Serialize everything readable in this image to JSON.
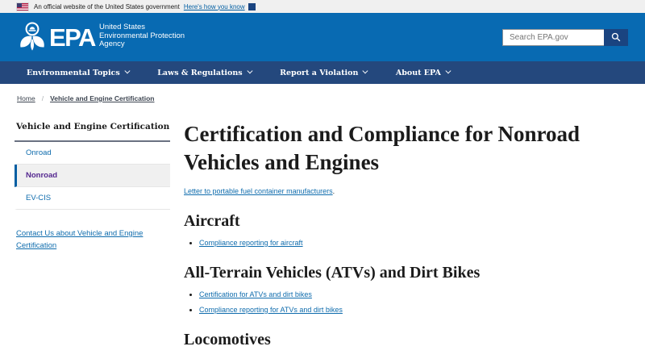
{
  "banner": {
    "text": "An official website of the United States government",
    "link_label": "Here's how you know"
  },
  "header": {
    "logo": {
      "acronym": "EPA",
      "tagline_lines": [
        "United States",
        "Environmental Protection",
        "Agency"
      ]
    },
    "search": {
      "placeholder": "Search EPA.gov"
    }
  },
  "nav": {
    "items": [
      {
        "label": "Environmental Topics"
      },
      {
        "label": "Laws & Regulations"
      },
      {
        "label": "Report a Violation"
      },
      {
        "label": "About EPA"
      }
    ]
  },
  "breadcrumb": {
    "separator": "/",
    "items": [
      {
        "label": "Home"
      },
      {
        "label": "Vehicle and Engine Certification"
      }
    ]
  },
  "sidebar": {
    "title": "Vehicle and Engine Certification",
    "items": [
      {
        "label": "Onroad",
        "current": false
      },
      {
        "label": "Nonroad",
        "current": true
      },
      {
        "label": "EV-CIS",
        "current": false
      }
    ],
    "contact_link": "Contact Us about Vehicle and Engine Certification"
  },
  "main": {
    "title": "Certification and Compliance for Nonroad Vehicles and Engines",
    "intro_link": "Letter to portable fuel container manufacturers",
    "intro_suffix": ".",
    "sections": [
      {
        "heading": "Aircraft",
        "links": [
          "Compliance reporting for aircraft"
        ]
      },
      {
        "heading": "All-Terrain Vehicles (ATVs) and Dirt Bikes",
        "links": [
          "Certification for ATVs and dirt bikes",
          "Compliance reporting for ATVs and dirt bikes"
        ]
      },
      {
        "heading": "Locomotives",
        "links": []
      }
    ]
  },
  "colors": {
    "header_blue": "#086ab2",
    "nav_navy": "#24487d",
    "button_navy": "#1a4480",
    "link_blue": "#0f6cad",
    "current_item_purple": "#54278f",
    "current_item_border": "#005ea2",
    "banner_gray": "#f0f0f0",
    "divider_slate": "#6a7181"
  }
}
